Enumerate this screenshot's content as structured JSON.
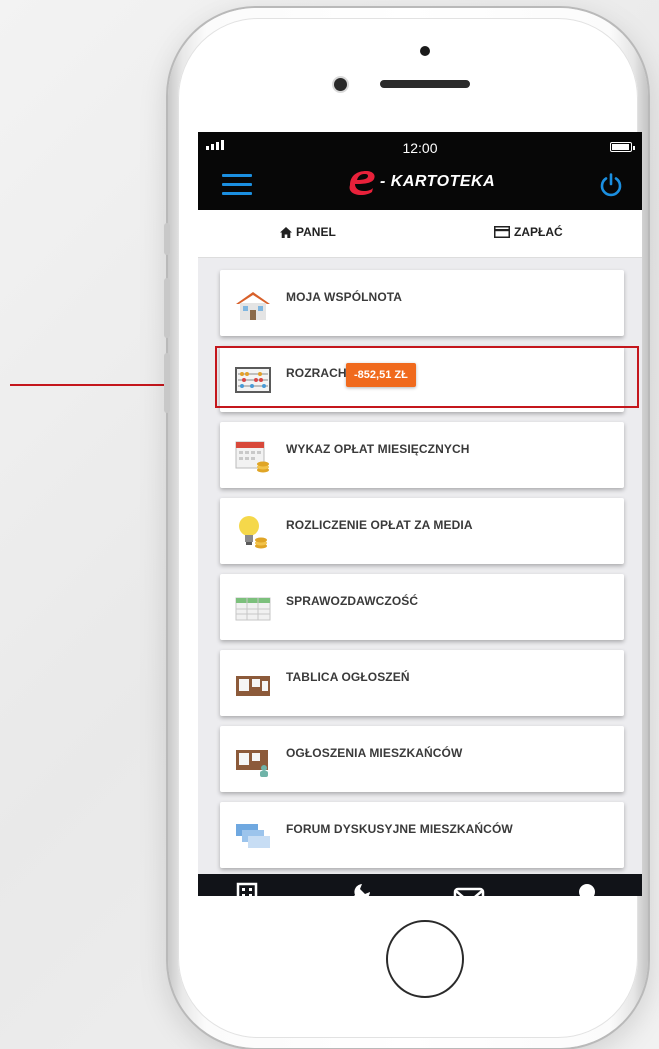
{
  "status": {
    "time": "12:00"
  },
  "app": {
    "title": "- KARTOTEKA"
  },
  "tabs": [
    {
      "label": "PANEL",
      "icon": "home-icon"
    },
    {
      "label": "ZAPŁAĆ",
      "icon": "card-icon"
    }
  ],
  "menu": [
    {
      "label": "MOJA WSPÓLNOTA",
      "icon": "house-icon"
    },
    {
      "label": "ROZRACHUNKI",
      "icon": "abacus-icon",
      "badge": "-852,51 ZŁ"
    },
    {
      "label": "WYKAZ OPŁAT MIESIĘCZNYCH",
      "icon": "calendar-coins-icon"
    },
    {
      "label": "ROZLICZENIE OPŁAT ZA MEDIA",
      "icon": "bulb-icon"
    },
    {
      "label": "SPRAWOZDAWCZOŚĆ",
      "icon": "spreadsheet-icon"
    },
    {
      "label": "TABLICA OGŁOSZEŃ",
      "icon": "board-icon"
    },
    {
      "label": "OGŁOSZENIA MIESZKAŃCÓW",
      "icon": "board-person-icon"
    },
    {
      "label": "FORUM DYSKUSYJNE MIESZKAŃCÓW",
      "icon": "chat-icon"
    }
  ],
  "bottom_nav": [
    "building-icon",
    "wrench-icon",
    "mail-icon",
    "user-icon"
  ],
  "colors": {
    "accent": "#1b8fe0",
    "badge": "#f06a1d",
    "highlight": "#c4161c",
    "logo": "#e8213a"
  }
}
